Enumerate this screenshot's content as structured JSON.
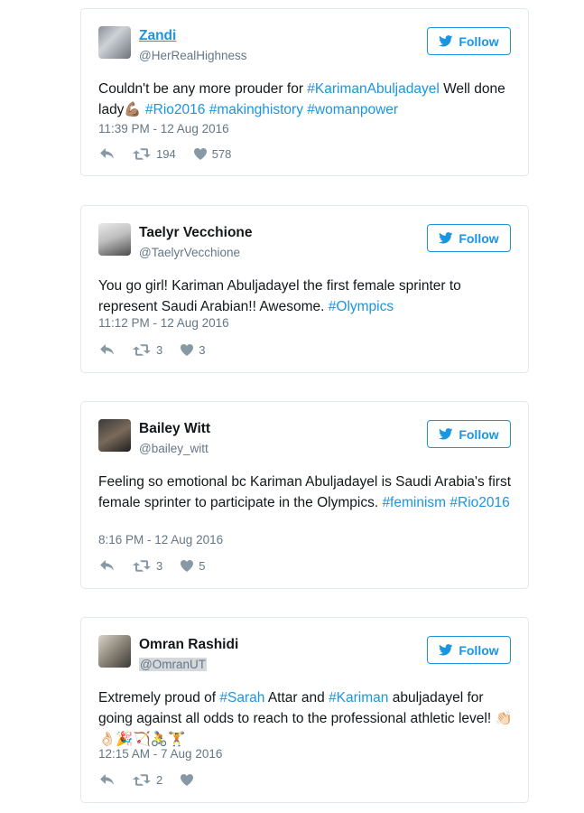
{
  "follow_label": "Follow",
  "tweets": [
    {
      "name": "Zandi",
      "handle": "@HerRealHighness",
      "text": [
        {
          "t": "Couldn't be any more prouder for ",
          "tag": false
        },
        {
          "t": "#KarimanAbuljadayel",
          "tag": true
        },
        {
          "t": " Well done lady💪🏽 ",
          "tag": false
        },
        {
          "t": "#Rio2016",
          "tag": true
        },
        {
          "t": " ",
          "tag": false
        },
        {
          "t": "#makinghistory",
          "tag": true
        },
        {
          "t": " ",
          "tag": false
        },
        {
          "t": "#womanpower",
          "tag": true
        }
      ],
      "date": "11:39 PM - 12 Aug 2016",
      "retweets": "194",
      "likes": "578"
    },
    {
      "name": "Taelyr Vecchione",
      "handle": "@TaelyrVecchione",
      "text": [
        {
          "t": "You go girl! Kariman Abuljadayel the first female sprinter to represent Saudi Arabian!! Awesome. ",
          "tag": false
        },
        {
          "t": "#Olympics",
          "tag": true
        }
      ],
      "date": "11:12 PM - 12 Aug 2016",
      "retweets": "3",
      "likes": "3"
    },
    {
      "name": "Bailey Witt",
      "handle": "@bailey_witt",
      "text": [
        {
          "t": "Feeling so emotional bc Kariman Abuljadayel is Saudi Arabia's first female sprinter to participate in the Olympics. ",
          "tag": false
        },
        {
          "t": "#feminism",
          "tag": true
        },
        {
          "t": " ",
          "tag": false
        },
        {
          "t": "#Rio2016",
          "tag": true
        }
      ],
      "date": "8:16 PM - 12 Aug 2016",
      "retweets": "3",
      "likes": "5"
    },
    {
      "name": "Omran Rashidi",
      "handle": "@OmranUT",
      "text": [
        {
          "t": "Extremely proud of ",
          "tag": false
        },
        {
          "t": "#Sarah",
          "tag": true
        },
        {
          "t": " Attar and ",
          "tag": false
        },
        {
          "t": "#Kariman",
          "tag": true
        },
        {
          "t": " abuljadayel for going against all odds to reach to the professional athletic level! 👏🏻👌🏻🎉🏹🚴🏋",
          "tag": false
        }
      ],
      "date": "12:15 AM - 7 Aug 2016",
      "retweets": "2",
      "likes": ""
    }
  ]
}
